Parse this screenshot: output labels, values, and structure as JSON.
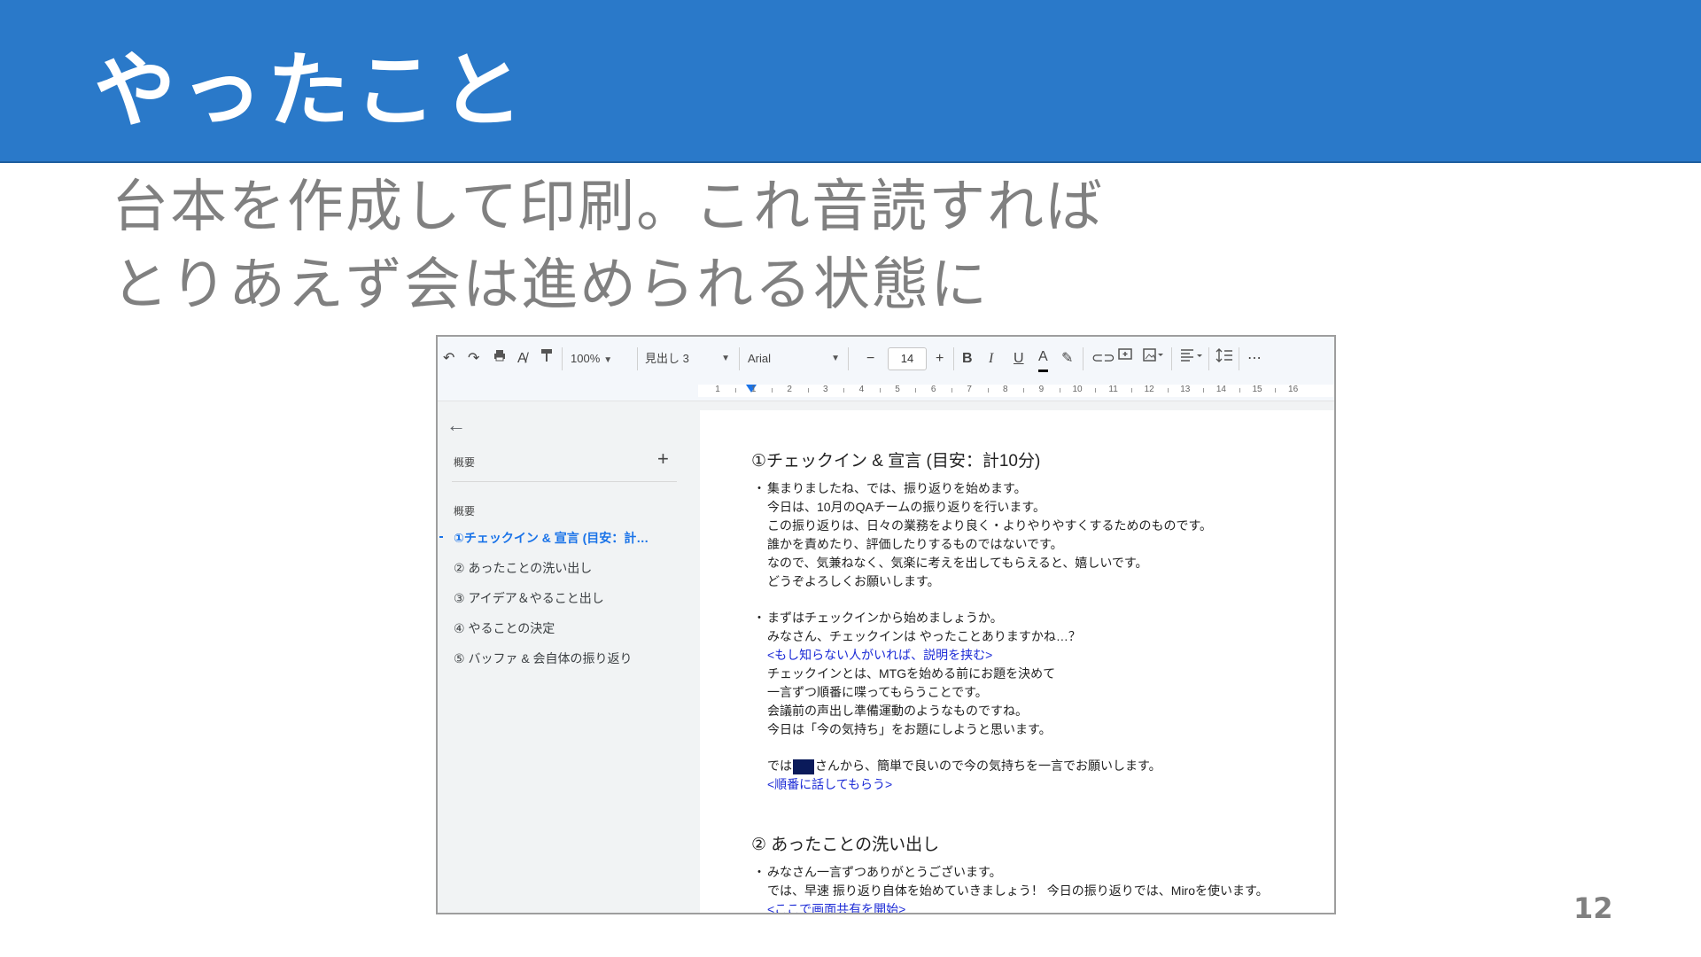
{
  "slide": {
    "title": "やったこと",
    "subtitle_line1": "台本を作成して印刷。これ音読すれば",
    "subtitle_line2": "とりあえず会は進められる状態に",
    "page_number": "12"
  },
  "toolbar": {
    "zoom": "100%",
    "style": "見出し 3",
    "font": "Arial",
    "font_size": "14",
    "minus": "−",
    "plus": "+",
    "bold": "B",
    "italic": "I",
    "underline": "U",
    "text_color": "A",
    "more": "⋯"
  },
  "ruler": {
    "numbers": [
      "1",
      "1",
      "2",
      "3",
      "4",
      "5",
      "6",
      "7",
      "8",
      "9",
      "10",
      "11",
      "12",
      "13",
      "14",
      "15",
      "16"
    ]
  },
  "outline": {
    "header": "概要",
    "subheader": "概要",
    "items": [
      "①チェックイン & 宣言 (目安：計…",
      "② あったことの洗い出し",
      "③ アイデア＆やること出し",
      "④ やることの決定",
      "⑤ バッファ & 会自体の振り返り"
    ]
  },
  "document": {
    "heading1": "①チェックイン & 宣言 (目安：計10分)",
    "p1": [
      "集まりましたね、では、振り返りを始めます。",
      "今日は、10月のQAチームの振り返りを行います。",
      "この振り返りは、日々の業務をより良く・よりやりやすくするためのものです。",
      "誰かを責めたり、評価したりするものではないです。",
      "なので、気兼ねなく、気楽に考えを出してもらえると、嬉しいです。",
      "どうぞよろしくお願いします。"
    ],
    "p2": [
      "まずはチェックインから始めましょうか。",
      "みなさん、チェックインは やったことありますかね…？"
    ],
    "p2_blue": "<もし知らない人がいれば、説明を挟む>",
    "p2_rest": [
      "チェックインとは、MTGを始める前にお題を決めて",
      "一言ずつ順番に喋ってもらうことです。",
      "会議前の声出し準備運動のようなものですね。",
      "今日は「今の気持ち」をお題にしようと思います。"
    ],
    "p3_before": "では",
    "p3_after": "さんから、簡単で良いので今の気持ちを一言でお願いします。",
    "p3_blue": "<順番に話してもらう>",
    "heading2": "② あったことの洗い出し",
    "p4": [
      "みなさん一言ずつありがとうございます。",
      "では、早速 振り返り自体を始めていきましょう！ 今日の振り返りでは、Miroを使います。"
    ],
    "p4_blue": "<ここで画面共有を開始>"
  }
}
